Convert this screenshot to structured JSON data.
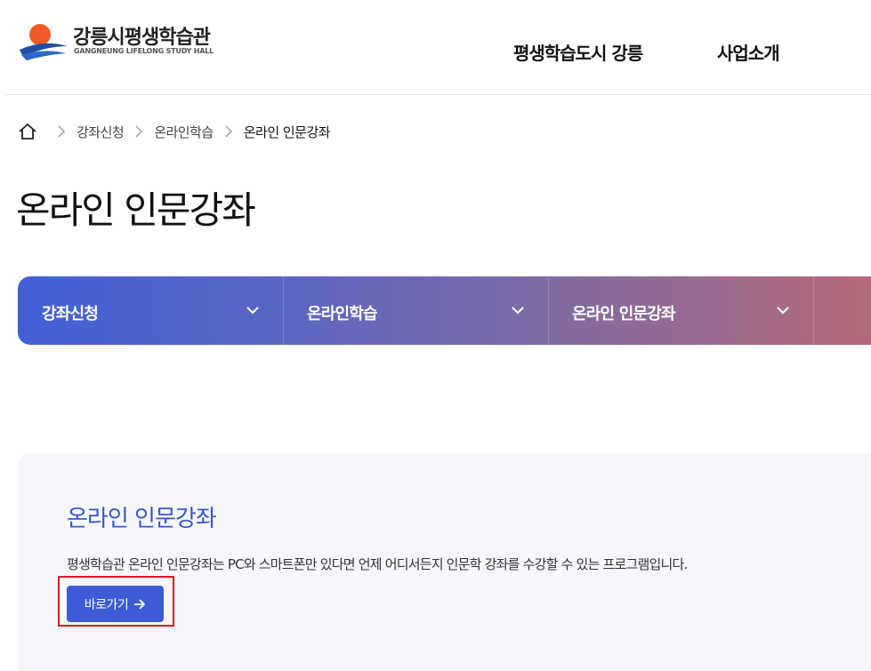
{
  "header": {
    "logo": {
      "title": "강릉시평생학습관",
      "subtitle": "GANGNEUNG LIFELONG STUDY HALL"
    },
    "nav": [
      {
        "label": "평생학습도시 강릉"
      },
      {
        "label": "사업소개"
      }
    ]
  },
  "breadcrumb": {
    "home_icon": "home-icon",
    "items": [
      {
        "label": "강좌신청"
      },
      {
        "label": "온라인학습"
      },
      {
        "label": "온라인 인문강좌"
      }
    ]
  },
  "page_title": "온라인 인문강좌",
  "tabs": [
    {
      "label": "강좌신청",
      "icon": "chevron-down-icon"
    },
    {
      "label": "온라인학습",
      "icon": "chevron-down-icon"
    },
    {
      "label": "온라인 인문강좌",
      "icon": "chevron-down-icon"
    }
  ],
  "info": {
    "title": "온라인 인문강좌",
    "description": "평생학습관 온라인 인문강좌는 PC와 스마트폰만 있다면 언제 어디서든지 인문학 강좌를 수강할 수 있는 프로그램입니다.",
    "button_label": "바로가기",
    "button_icon": "arrow-right-icon"
  },
  "colors": {
    "accent": "#3d5bd6",
    "title_blue": "#3a57c6",
    "highlight": "#e0141e",
    "tab_gradient_start": "#4260d6",
    "tab_gradient_end": "#b26a78"
  }
}
